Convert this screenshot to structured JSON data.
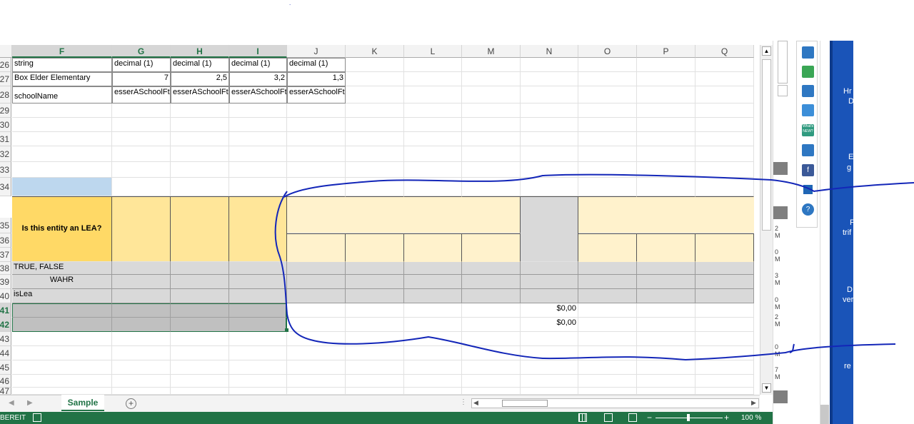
{
  "columns": [
    "F",
    "G",
    "H",
    "I",
    "J",
    "K",
    "L",
    "M",
    "N",
    "O",
    "P",
    "Q"
  ],
  "selected_columns": [
    "F",
    "G",
    "H",
    "I"
  ],
  "rows": [
    {
      "num": "26",
      "sel": false
    },
    {
      "num": "27",
      "sel": false
    },
    {
      "num": "28",
      "sel": false
    },
    {
      "num": "29",
      "sel": false
    },
    {
      "num": "30",
      "sel": false
    },
    {
      "num": "31",
      "sel": false
    },
    {
      "num": "32",
      "sel": false
    },
    {
      "num": "33",
      "sel": false
    },
    {
      "num": "34",
      "sel": false
    },
    {
      "num": "35",
      "sel": false
    },
    {
      "num": "36",
      "sel": false
    },
    {
      "num": "37",
      "sel": false
    },
    {
      "num": "38",
      "sel": false
    },
    {
      "num": "39",
      "sel": false
    },
    {
      "num": "40",
      "sel": false
    },
    {
      "num": "41",
      "sel": true
    },
    {
      "num": "42",
      "sel": true
    },
    {
      "num": "43",
      "sel": false
    },
    {
      "num": "44",
      "sel": false
    },
    {
      "num": "45",
      "sel": false
    },
    {
      "num": "46",
      "sel": false
    },
    {
      "num": "47",
      "sel": false
    }
  ],
  "cells": {
    "F26": "string",
    "G26": "decimal (1)",
    "H26": "decimal (1)",
    "I26": "decimal (1)",
    "J26": "decimal (1)",
    "F27": "Box Elder Elementary",
    "G27": "7",
    "H27": "2,5",
    "I27": "3,2",
    "J27": "1,3",
    "F28": "schoolName",
    "G28": "esserASchoolFteSpecialEd",
    "H28": "esserASchoolFteBilingual",
    "I28": "esserASchoolFteCounselors",
    "J28": "esserASchoolFteNurses",
    "F35": "Is this entity an LEA?",
    "F38": "TRUE, FALSE",
    "F39": "WAHR",
    "F40": "isLea",
    "N41": "$0,00",
    "N42": "$0,00"
  },
  "sheet_tab": "Sample",
  "status_left": "BEREIT",
  "zoom": "100 %",
  "right_panel_icons": [
    "home-icon",
    "chat-icon",
    "person-icon",
    "search-icon",
    "whats-new-icon",
    "keyboard-icon",
    "facebook-icon",
    "window-icon",
    "help-icon"
  ],
  "right_panel_whats_new": "What's NEW?",
  "right_panel_help": "?",
  "right_panel_facebook": "f",
  "desktop_labels": [
    "Hr",
    "D",
    "E",
    "g",
    "F",
    "trif",
    "D",
    "ver",
    "re"
  ],
  "scroll_side_labels": [
    "2",
    "M",
    "0",
    "M",
    "3",
    "M",
    "0",
    "M",
    "2",
    "M",
    "0",
    "M",
    "7",
    "M"
  ],
  "colors": {
    "excel_green": "#217346",
    "header_yellow": "#ffd966",
    "light_yellow": "#ffe699",
    "pale_yellow": "#fff2cc",
    "grey": "#d9d9d9",
    "ink": "#1326b8",
    "selected_blue": "#bdd7ee"
  }
}
